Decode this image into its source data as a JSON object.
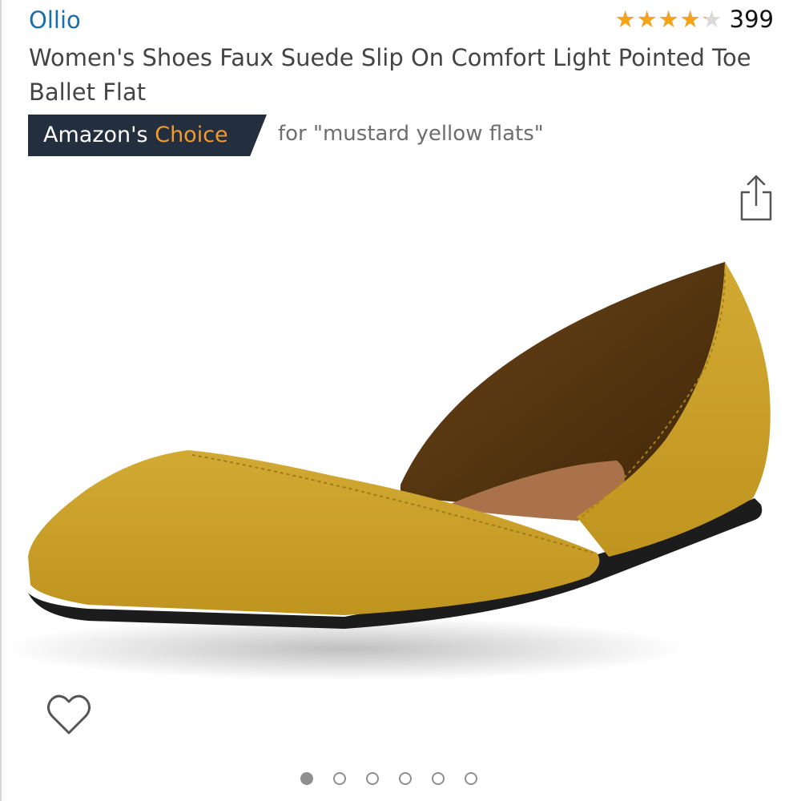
{
  "product": {
    "brand": "Ollio",
    "title": "Women's Shoes Faux Suede Slip On Comfort Light Pointed Toe Ballet Flat",
    "rating": {
      "stars_out_of_5": 4.2,
      "star_glyphs": "★★★★★",
      "count": "399"
    },
    "badge": {
      "prefix": "Amazon's",
      "highlight": "Choice",
      "context": "for \"mustard yellow flats\""
    }
  },
  "gallery": {
    "image_count": 6,
    "active_index": 0,
    "image_subject": "mustard-yellow-suede-pointed-toe-flat"
  },
  "icons": {
    "share": "share-icon",
    "wishlist": "heart-icon"
  },
  "colors": {
    "brand_link": "#1a6fa8",
    "star": "#f3a419",
    "badge_bg": "#232f3e",
    "badge_accent": "#f39a2c",
    "shoe_suede": "#c9a02a"
  }
}
